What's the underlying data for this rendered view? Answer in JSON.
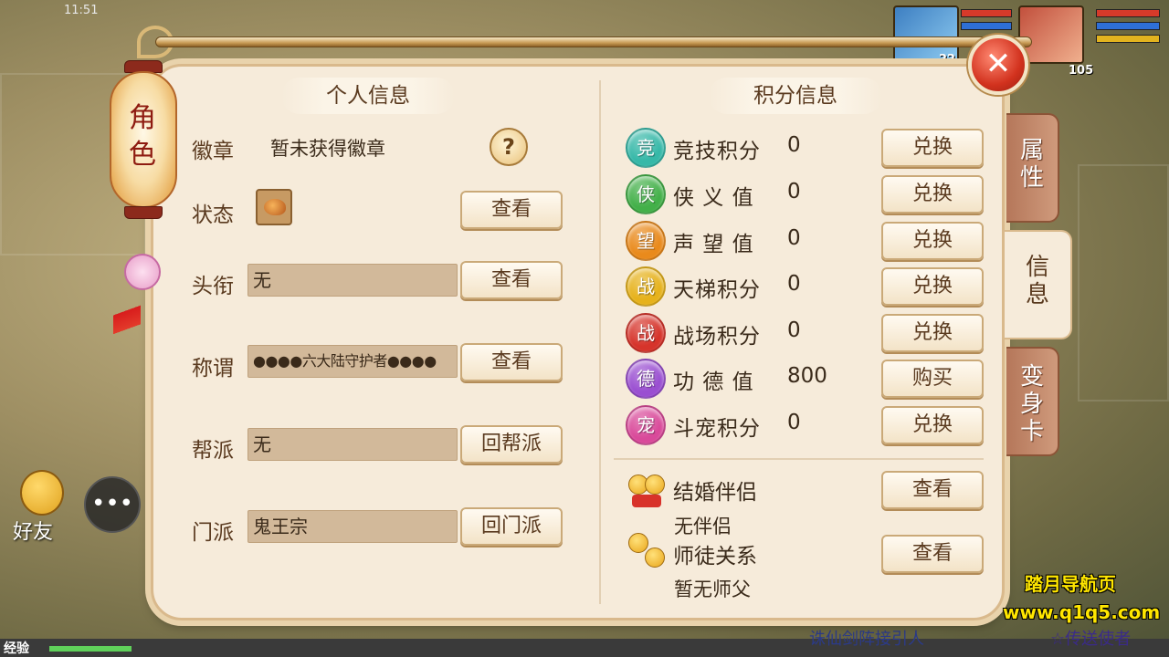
{
  "status_bar": {
    "time": "11:51"
  },
  "hud": {
    "player_level": "22",
    "pet_level": "105",
    "friend_label": "好友",
    "exp_label": "经验",
    "bottom_message": "诛仙剑阵接引人",
    "bottom_message_right": "☆传送使者"
  },
  "lantern": {
    "title": "角色"
  },
  "personal": {
    "header": "个人信息",
    "badge": {
      "label": "徽章",
      "value": "暂未获得徽章",
      "help": "?"
    },
    "state": {
      "label": "状态",
      "button": "查看"
    },
    "title": {
      "label": "头衔",
      "value": "无",
      "button": "查看"
    },
    "appellation": {
      "label": "称谓",
      "value": "●●●●六大陆守护者●●●●",
      "button": "查看"
    },
    "guild": {
      "label": "帮派",
      "value": "无",
      "button": "回帮派"
    },
    "sect": {
      "label": "门派",
      "value": "鬼王宗",
      "button": "回门派"
    }
  },
  "scores": {
    "header": "积分信息",
    "items": [
      {
        "badge": "竞",
        "label": "竞技积分",
        "value": "0",
        "button": "兑换",
        "color": "#36b8a8"
      },
      {
        "badge": "侠",
        "label": "侠 义 值",
        "value": "0",
        "button": "兑换",
        "color": "#43b049"
      },
      {
        "badge": "望",
        "label": "声 望 值",
        "value": "0",
        "button": "兑换",
        "color": "#e98a1c"
      },
      {
        "badge": "战",
        "label": "天梯积分",
        "value": "0",
        "button": "兑换",
        "color": "#e6b21c"
      },
      {
        "badge": "战",
        "label": "战场积分",
        "value": "0",
        "button": "兑换",
        "color": "#d6342b"
      },
      {
        "badge": "德",
        "label": "功 德 值",
        "value": "800",
        "button": "购买",
        "color": "#9a4fd1"
      },
      {
        "badge": "宠",
        "label": "斗宠积分",
        "value": "0",
        "button": "兑换",
        "color": "#d94a9a"
      }
    ]
  },
  "relations": {
    "marriage": {
      "label": "结婚伴侣",
      "value": "无伴侣",
      "button": "查看"
    },
    "mentor": {
      "label": "师徒关系",
      "value": "暂无师父",
      "button": "查看"
    }
  },
  "tabs": [
    {
      "label": "属性"
    },
    {
      "label": "信息"
    },
    {
      "label": "变身卡"
    }
  ],
  "close_label": "✕",
  "watermark": {
    "line1": "踏月导航页",
    "line2": "www.q1q5.com"
  }
}
